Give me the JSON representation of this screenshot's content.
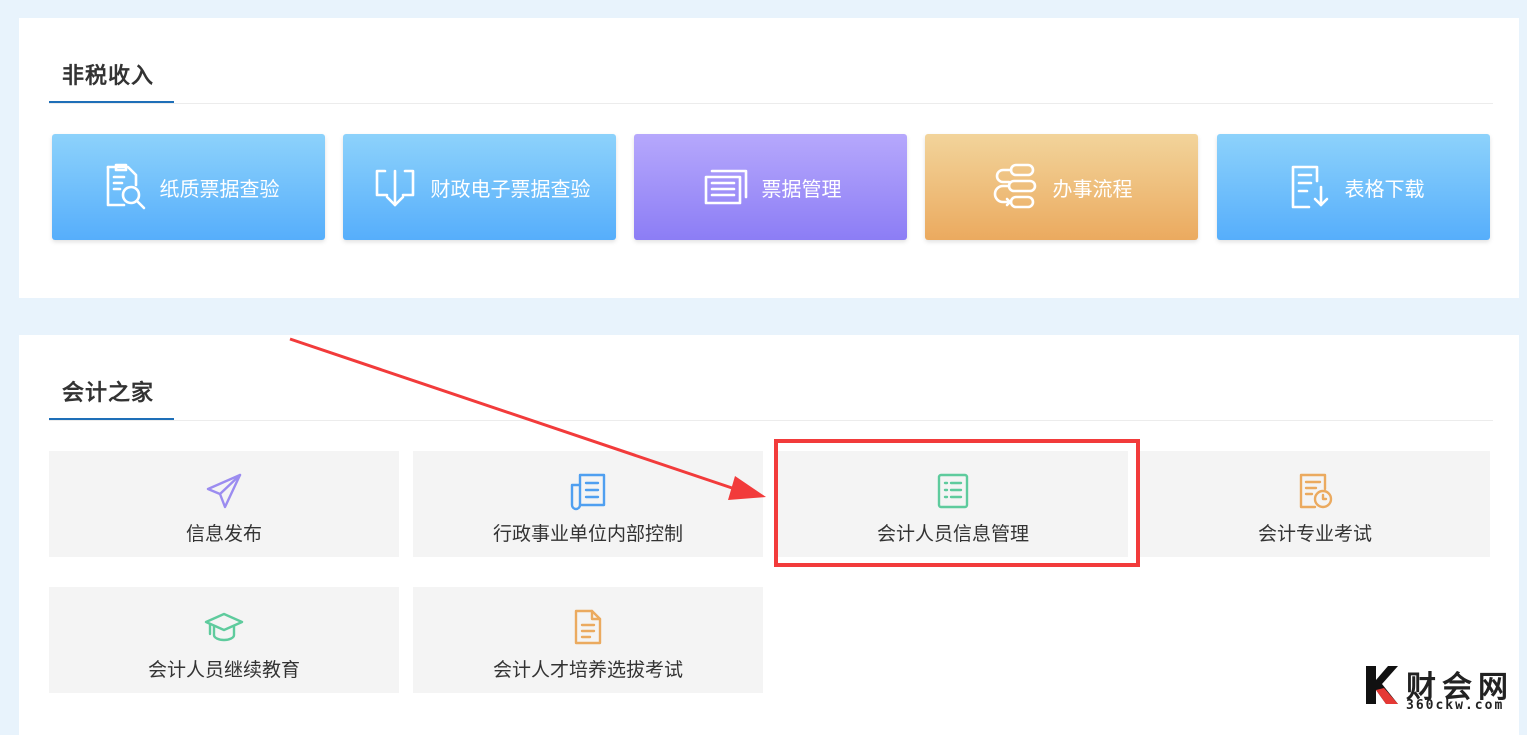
{
  "sections": {
    "non_tax": {
      "title": "非税收入",
      "tiles": [
        {
          "label": "纸质票据查验",
          "icon": "paper-invoice-search-icon",
          "style": "blue"
        },
        {
          "label": "财政电子票据查验",
          "icon": "download-tray-icon",
          "style": "blue"
        },
        {
          "label": "票据管理",
          "icon": "tickets-stack-icon",
          "style": "purple"
        },
        {
          "label": "办事流程",
          "icon": "process-flow-icon",
          "style": "orange"
        },
        {
          "label": "表格下载",
          "icon": "form-download-icon",
          "style": "blue"
        }
      ]
    },
    "accounting": {
      "title": "会计之家",
      "cards": [
        {
          "label": "信息发布",
          "icon": "paper-plane-icon",
          "color": "#9b8cf0"
        },
        {
          "label": "行政事业单位内部控制",
          "icon": "document-pages-icon",
          "color": "#4f9ff0"
        },
        {
          "label": "会计人员信息管理",
          "icon": "list-document-icon",
          "color": "#5ecb9d"
        },
        {
          "label": "会计专业考试",
          "icon": "document-clock-icon",
          "color": "#ebaa5f"
        },
        {
          "label": "会计人员继续教育",
          "icon": "graduation-cap-icon",
          "color": "#5ecb9d"
        },
        {
          "label": "会计人才培养选拔考试",
          "icon": "file-text-icon",
          "color": "#ebaa5f"
        }
      ]
    }
  },
  "watermark": {
    "name": "财会网",
    "url": "360ckw.com"
  },
  "colors": {
    "highlight": "#f23b3b",
    "accent_line": "#1e6fb8",
    "page_bg": "#e8f3fc"
  }
}
